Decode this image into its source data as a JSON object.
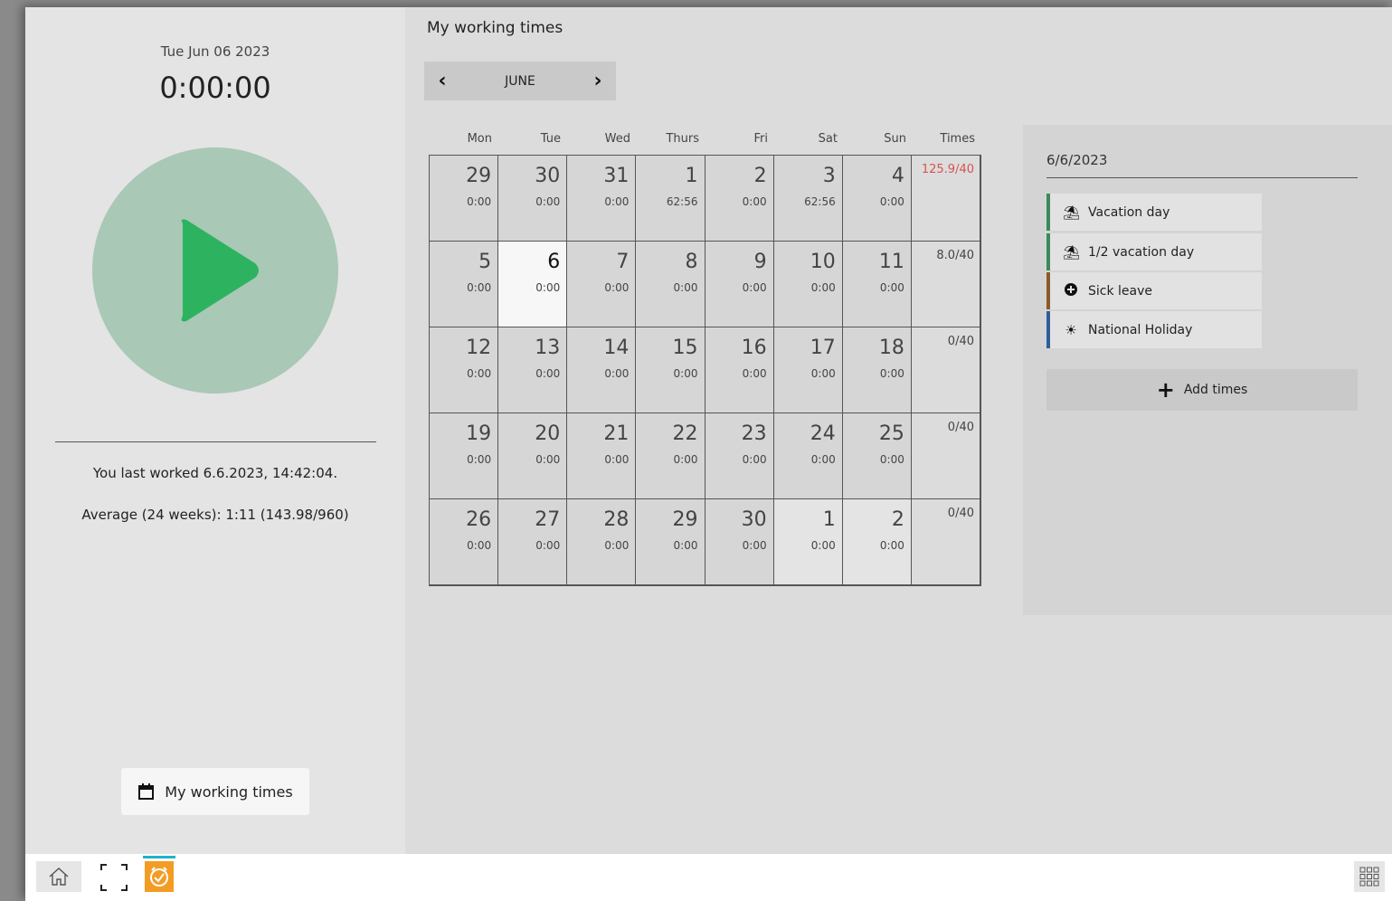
{
  "left_panel": {
    "date": "Tue Jun 06 2023",
    "timer": "0:00:00",
    "last_worked": "You last worked 6.6.2023, 14:42:04.",
    "average": "Average (24 weeks): 1:11 (143.98/960)",
    "my_working_times_button": "My working times"
  },
  "main": {
    "title": "My working times",
    "month": "JUNE",
    "prev_icon": "chevron-left-icon",
    "next_icon": "chevron-right-icon",
    "headers": [
      "Mon",
      "Tue",
      "Wed",
      "Thurs",
      "Fri",
      "Sat",
      "Sun",
      "Times"
    ],
    "weeks": [
      {
        "days": [
          [
            "29",
            "0:00"
          ],
          [
            "30",
            "0:00"
          ],
          [
            "31",
            "0:00"
          ],
          [
            "1",
            "62:56"
          ],
          [
            "2",
            "0:00"
          ],
          [
            "3",
            "62:56"
          ],
          [
            "4",
            "0:00"
          ]
        ],
        "total": "125.9/40"
      },
      {
        "days": [
          [
            "5",
            "0:00"
          ],
          [
            "6",
            "0:00"
          ],
          [
            "7",
            "0:00"
          ],
          [
            "8",
            "0:00"
          ],
          [
            "9",
            "0:00"
          ],
          [
            "10",
            "0:00"
          ],
          [
            "11",
            "0:00"
          ]
        ],
        "total": "8.0/40"
      },
      {
        "days": [
          [
            "12",
            "0:00"
          ],
          [
            "13",
            "0:00"
          ],
          [
            "14",
            "0:00"
          ],
          [
            "15",
            "0:00"
          ],
          [
            "16",
            "0:00"
          ],
          [
            "17",
            "0:00"
          ],
          [
            "18",
            "0:00"
          ]
        ],
        "total": "0/40"
      },
      {
        "days": [
          [
            "19",
            "0:00"
          ],
          [
            "20",
            "0:00"
          ],
          [
            "21",
            "0:00"
          ],
          [
            "22",
            "0:00"
          ],
          [
            "23",
            "0:00"
          ],
          [
            "24",
            "0:00"
          ],
          [
            "25",
            "0:00"
          ]
        ],
        "total": "0/40"
      },
      {
        "days": [
          [
            "26",
            "0:00"
          ],
          [
            "27",
            "0:00"
          ],
          [
            "28",
            "0:00"
          ],
          [
            "29",
            "0:00"
          ],
          [
            "30",
            "0:00"
          ],
          [
            "1",
            "0:00"
          ],
          [
            "2",
            "0:00"
          ]
        ],
        "total": "0/40"
      }
    ],
    "colors": {
      "over_total": "#d9534f",
      "today_bg": "#f7f7f7"
    }
  },
  "side_panel": {
    "date": "6/6/2023",
    "entries": [
      {
        "label": "Vacation day",
        "icon": "umbrella-beach-icon",
        "color": "#3a8a5c"
      },
      {
        "label": "1/2 vacation day",
        "icon": "umbrella-beach-icon",
        "color": "#3a8a5c"
      },
      {
        "label": "Sick leave",
        "icon": "plus-circle-icon",
        "color": "#8b5a2b"
      },
      {
        "label": "National Holiday",
        "icon": "sun-icon",
        "color": "#2f5d9a"
      }
    ],
    "add_times": "Add times"
  },
  "taskbar": {
    "home_icon": "home-icon",
    "fullscreen_icon": "fullscreen-icon",
    "app_icon": "clock-check-icon",
    "apps_icon": "app-grid-icon",
    "accent": "#27b0c5",
    "app_color": "#f39c24"
  }
}
